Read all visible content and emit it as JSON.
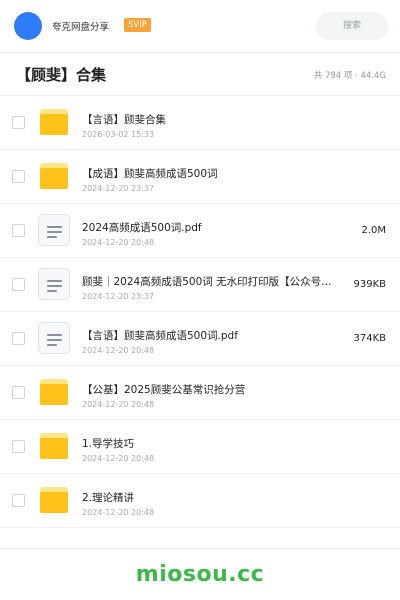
{
  "header": {
    "brand": "夸克网盘分享",
    "badge": "SVIP",
    "search_label": "搜索"
  },
  "folder_title": "【顾斐】合集",
  "summary": "共 794 项 · 44.4G",
  "items": [
    {
      "type": "folder",
      "name": "【言语】顾斐合集",
      "date": "2026-03-02 15:33",
      "size": ""
    },
    {
      "type": "folder",
      "name": "【成语】顾斐高频成语500词",
      "date": "2024-12-20 23:37",
      "size": ""
    },
    {
      "type": "file",
      "name": "2024高频成语500词.pdf",
      "date": "2024-12-20 20:48",
      "size": "2.0M"
    },
    {
      "type": "file",
      "name": "顾斐｜2024高频成语500词 无水印打印版【公众号：…",
      "date": "2024-12-20 23:37",
      "size": "939KB"
    },
    {
      "type": "file",
      "name": "【言语】顾斐高频成语500词.pdf",
      "date": "2024-12-20 20:48",
      "size": "374KB"
    },
    {
      "type": "folder",
      "name": "【公基】2025顾斐公基常识抢分营",
      "date": "2024-12-20 20:48",
      "size": ""
    },
    {
      "type": "folder",
      "name": "1.导学技巧",
      "date": "2024-12-20 20:48",
      "size": ""
    },
    {
      "type": "folder",
      "name": "2.理论精讲",
      "date": "2024-12-20 20:48",
      "size": ""
    }
  ],
  "icons": {
    "avatar": "avatar",
    "folder": "folder-icon",
    "file": "document-icon",
    "checkbox": "checkbox"
  },
  "colors": {
    "accent": "#2f7df6",
    "svip": "#f8a23a",
    "folder": "#ffc21a",
    "watermark": "#3db84a"
  },
  "watermark": "miosou.cc"
}
